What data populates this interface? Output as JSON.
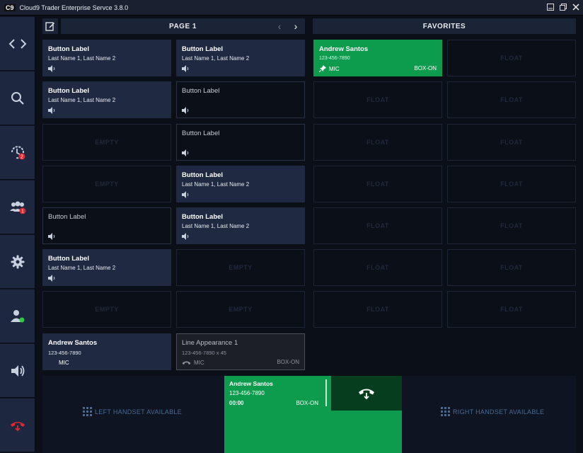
{
  "app": {
    "logo": "C9",
    "title": "Cloud9 Trader Enterprise Servce 3.8.0"
  },
  "window_controls": [
    "minimize-icon",
    "restore-icon",
    "close-icon"
  ],
  "sidebar": [
    {
      "icon": "code-brackets-icon"
    },
    {
      "icon": "search-icon"
    },
    {
      "icon": "history-icon",
      "badge": "2"
    },
    {
      "icon": "contacts-icon",
      "badge": "1"
    },
    {
      "icon": "gear-icon"
    },
    {
      "icon": "user-status-icon"
    },
    {
      "icon": "speaker-icon"
    },
    {
      "icon": "hangup-icon"
    }
  ],
  "page_header": {
    "title": "PAGE 1",
    "prev": "‹",
    "next": "›"
  },
  "favorites_header": {
    "title": "FAVORITES"
  },
  "placeholders": {
    "empty": "EMPTY",
    "float": "FLOAT"
  },
  "buttons": {
    "r1c1": {
      "title": "Button Label",
      "sub": "Last Name 1, Last Name 2"
    },
    "r1c2": {
      "title": "Button Label",
      "sub": "Last Name 1, Last Name 2"
    },
    "r2c1": {
      "title": "Button Label",
      "sub": "Last Name 1, Last Name 2"
    },
    "r2c2": {
      "title": "Button Label"
    },
    "r3c2": {
      "title": "Button Label"
    },
    "r4c2": {
      "title": "Button Label",
      "sub": "Last Name 1, Last Name 2"
    },
    "r5c1": {
      "title": "Button Label"
    },
    "r5c2": {
      "title": "Button Label",
      "sub": "Last Name 1, Last Name 2"
    },
    "r6c1": {
      "title": "Button Label",
      "sub": "Last Name 1, Last Name 2"
    }
  },
  "favorite_active": {
    "name": "Andrew Santos",
    "number": "123-456-7890",
    "mic": "MIC",
    "box": "BOX-ON"
  },
  "line_left": {
    "name": "Andrew Santos",
    "number": "123-456-7890",
    "mic": "MIC"
  },
  "line_right": {
    "name": "Line Appearance 1",
    "number": "123-456-7890 x 45",
    "mic": "MIC",
    "box": "BOX-ON"
  },
  "active_call": {
    "name": "Andrew Santos",
    "number": "123-456-7890",
    "time": "00:00",
    "box": "BOX-ON"
  },
  "handsets": {
    "left": "LEFT HANDSET AVAILABLE",
    "right": "RIGHT HANDSET AVAILABLE"
  },
  "colors": {
    "green": "#0d9b4d",
    "dark_green": "#063d1f",
    "tile": "#1f2a42",
    "badge": "#e0262f",
    "online": "#2ecc40"
  }
}
